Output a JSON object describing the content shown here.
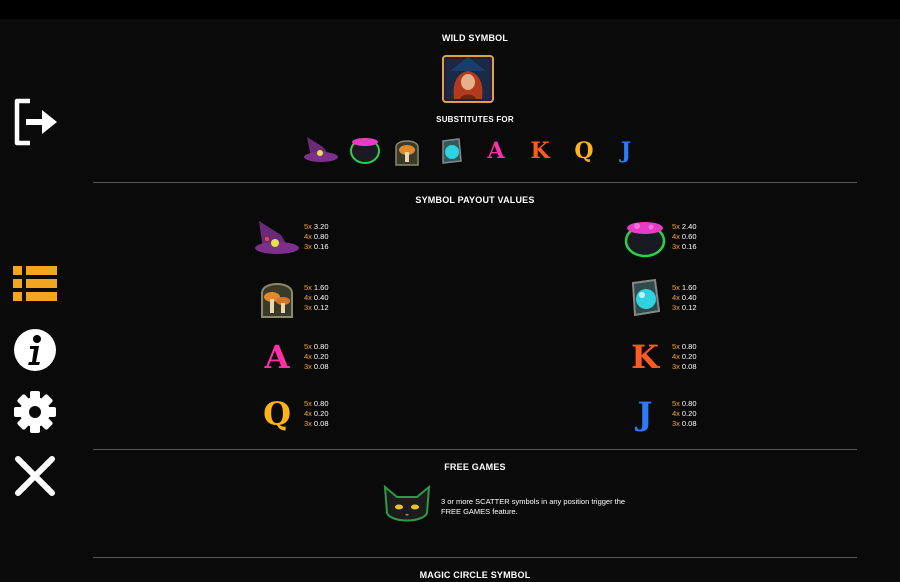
{
  "sidebar": {
    "exit_icon": "exit-door-icon",
    "paytable_icon": "list-icon",
    "info_icon": "info-icon",
    "settings_icon": "gear-icon",
    "close_icon": "close-icon"
  },
  "wild": {
    "title": "WILD SYMBOL",
    "substitutes_title": "SUBSTITUTES FOR",
    "substitutes": [
      {
        "icon": "witch-hat-symbol"
      },
      {
        "icon": "cauldron-symbol"
      },
      {
        "icon": "mushroom-jar-symbol"
      },
      {
        "icon": "potion-symbol"
      },
      {
        "letter": "A",
        "color": "#ff2fa5"
      },
      {
        "letter": "K",
        "color": "#ff5a1f"
      },
      {
        "letter": "Q",
        "color": "#ffb21a"
      },
      {
        "letter": "J",
        "color": "#2c7bff"
      }
    ]
  },
  "payouts": {
    "title": "SYMBOL PAYOUT VALUES",
    "left": [
      {
        "symbol": "witch-hat",
        "lines": [
          {
            "count": "5x",
            "value": "3.20"
          },
          {
            "count": "4x",
            "value": "0.80"
          },
          {
            "count": "3x",
            "value": "0.16"
          }
        ]
      },
      {
        "symbol": "mushroom-jar",
        "lines": [
          {
            "count": "5x",
            "value": "1.60"
          },
          {
            "count": "4x",
            "value": "0.40"
          },
          {
            "count": "3x",
            "value": "0.12"
          }
        ]
      },
      {
        "letter": "A",
        "color": "#ff2fa5",
        "lines": [
          {
            "count": "5x",
            "value": "0.80"
          },
          {
            "count": "4x",
            "value": "0.20"
          },
          {
            "count": "3x",
            "value": "0.08"
          }
        ]
      },
      {
        "letter": "Q",
        "color": "#ffb21a",
        "lines": [
          {
            "count": "5x",
            "value": "0.80"
          },
          {
            "count": "4x",
            "value": "0.20"
          },
          {
            "count": "3x",
            "value": "0.08"
          }
        ]
      }
    ],
    "right": [
      {
        "symbol": "cauldron",
        "lines": [
          {
            "count": "5x",
            "value": "2.40"
          },
          {
            "count": "4x",
            "value": "0.60"
          },
          {
            "count": "3x",
            "value": "0.16"
          }
        ]
      },
      {
        "symbol": "potion",
        "lines": [
          {
            "count": "5x",
            "value": "1.60"
          },
          {
            "count": "4x",
            "value": "0.40"
          },
          {
            "count": "3x",
            "value": "0.12"
          }
        ]
      },
      {
        "letter": "K",
        "color": "#ff5a1f",
        "lines": [
          {
            "count": "5x",
            "value": "0.80"
          },
          {
            "count": "4x",
            "value": "0.20"
          },
          {
            "count": "3x",
            "value": "0.08"
          }
        ]
      },
      {
        "letter": "J",
        "color": "#2c7bff",
        "lines": [
          {
            "count": "5x",
            "value": "0.80"
          },
          {
            "count": "4x",
            "value": "0.20"
          },
          {
            "count": "3x",
            "value": "0.08"
          }
        ]
      }
    ]
  },
  "free_games": {
    "title": "FREE GAMES",
    "text_line1": "3 or more SCATTER symbols in any position trigger the",
    "text_line2": "FREE GAMES feature."
  },
  "magic_circle": {
    "title": "MAGIC CIRCLE SYMBOL"
  }
}
